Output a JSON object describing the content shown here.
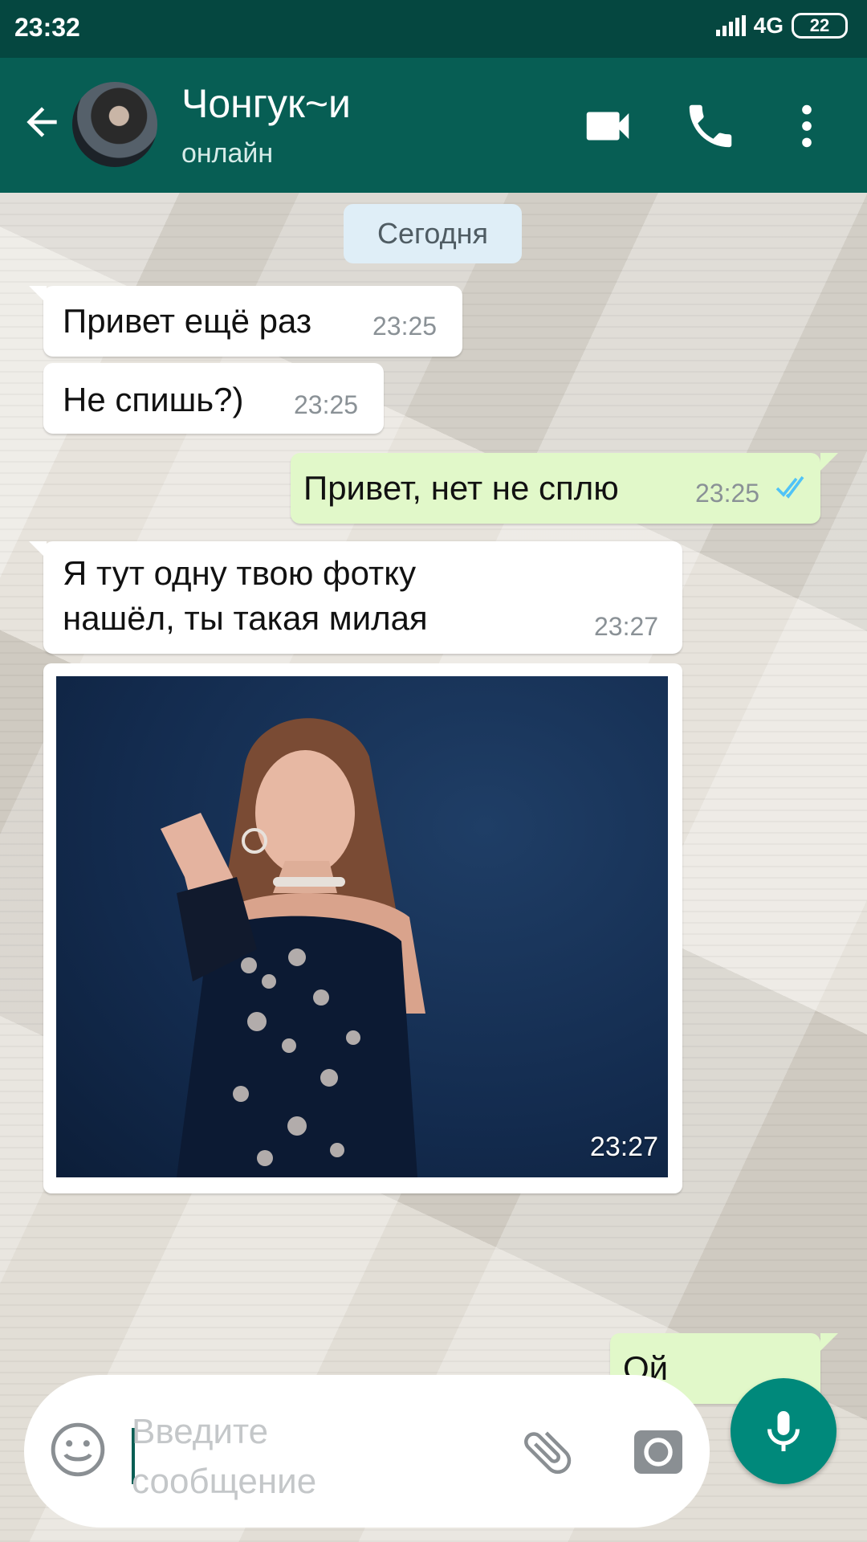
{
  "status_bar": {
    "time": "23:32",
    "network": "4G",
    "battery": "22"
  },
  "header": {
    "contact_name": "Чонгук~и",
    "contact_status": "онлайн",
    "icons": [
      "back-arrow-icon",
      "video-call-icon",
      "phone-icon",
      "more-vert-icon"
    ]
  },
  "chat": {
    "date_label": "Сегодня",
    "messages": [
      {
        "direction": "incoming",
        "text": "Привет ещё раз",
        "time": "23:25"
      },
      {
        "direction": "incoming",
        "text": "Не спишь?)",
        "time": "23:25"
      },
      {
        "direction": "outgoing",
        "text": "Привет, нет не сплю",
        "time": "23:25",
        "status": "read"
      },
      {
        "direction": "incoming",
        "text_line1": "Я тут одну твою фотку",
        "text_line2": "нашёл, ты такая милая",
        "time": "23:27"
      },
      {
        "direction": "incoming",
        "type": "photo",
        "time": "23:27"
      },
      {
        "direction": "outgoing",
        "text": "Ой",
        "time": ""
      }
    ]
  },
  "input": {
    "placeholder_line1": "Введите",
    "placeholder_line2": "сообщение",
    "icons": [
      "emoji-icon",
      "attach-icon",
      "camera-icon",
      "mic-icon"
    ]
  },
  "colors": {
    "header": "#075e54",
    "status_bar": "#054740",
    "incoming_bubble": "#ffffff",
    "outgoing_bubble": "#e1f8c9",
    "accent": "#00897b",
    "read_ticks": "#4fc3f7"
  }
}
